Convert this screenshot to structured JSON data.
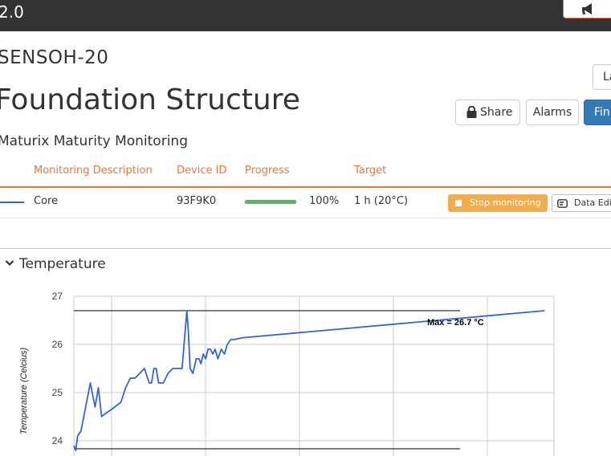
{
  "topbar": {
    "version": "2.0",
    "announce_icon": "megaphone-icon"
  },
  "project": {
    "code": "SENSOH-20",
    "title": "Foundation Structure",
    "subtitle": "Maturix Maturity Monitoring"
  },
  "actions": {
    "la_label": "La",
    "share_label": "Share",
    "alarms_label": "Alarms",
    "finish_label": "Fini"
  },
  "table": {
    "headers": [
      "Monitoring Description",
      "Device ID",
      "Progress",
      "Target"
    ],
    "row": {
      "description": "Core",
      "device_id": "93F9K0",
      "progress_text": "100%",
      "progress": 1.0,
      "target": "1 h (20°C)",
      "stop_label": "Stop monitoring",
      "data_label": "Data Edi"
    }
  },
  "colors": {
    "accent": "#e8763a",
    "series": "#3366cc",
    "success": "#5cb85c",
    "warning": "#f0ad4e",
    "primary": "#337ab7"
  },
  "section": {
    "title": "Temperature"
  },
  "chart_data": {
    "type": "line",
    "ylabel": "Temperature (Celcius)",
    "yticks": [
      "27",
      "26",
      "25",
      "24"
    ],
    "ylim": [
      23.8,
      27.3
    ],
    "xlim": [
      0,
      102
    ],
    "grid": true,
    "annotation": "Max = 26.7 °C",
    "max_value": 26.7,
    "min_value": 23.8,
    "series": [
      {
        "x": [
          0,
          0.4,
          0.8,
          1.5,
          2.5,
          3.5,
          4.5,
          5.2,
          5.9,
          6.5,
          8,
          10,
          11,
          12,
          13,
          14,
          15,
          15.5,
          16,
          16.5,
          17,
          17.5,
          18,
          19,
          20,
          21,
          22,
          23,
          24,
          24.3,
          24.7,
          25.3,
          26,
          26.6,
          27,
          27.5,
          28,
          28.5,
          29,
          29.5,
          30,
          30.6,
          31.3,
          32,
          32.6,
          33.3,
          34,
          35,
          36,
          100
        ],
        "y": [
          23.9,
          23.8,
          24.1,
          24.2,
          24.7,
          25.2,
          24.7,
          25.1,
          24.5,
          24.55,
          24.65,
          24.8,
          25.1,
          25.3,
          25.3,
          25.4,
          25.5,
          25.35,
          25.2,
          25.2,
          25.5,
          25.5,
          25.2,
          25.2,
          25.4,
          25.5,
          25.5,
          25.5,
          26.7,
          26.3,
          25.5,
          25.4,
          25.7,
          25.7,
          25.6,
          25.8,
          25.7,
          25.9,
          25.9,
          25.8,
          25.9,
          25.7,
          25.9,
          25.8,
          26.0,
          26.1,
          26.1,
          26.12,
          26.14,
          26.7
        ]
      }
    ]
  }
}
